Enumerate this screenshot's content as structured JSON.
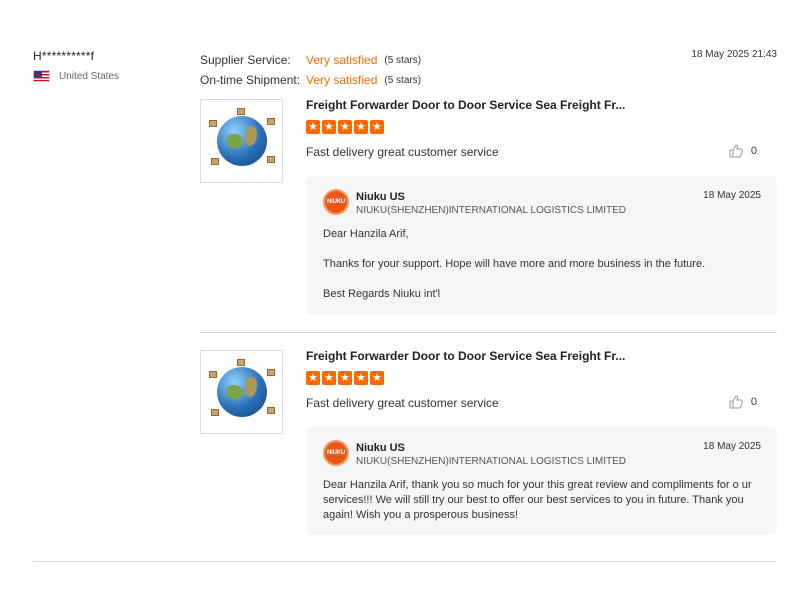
{
  "reviewer": {
    "name": "H**********f",
    "country": "United States",
    "flag_icon": "us-flag-icon"
  },
  "ratings": [
    {
      "label": "Supplier Service:",
      "value": "Very satisfied",
      "stars": "(5 stars)"
    },
    {
      "label": "On-time Shipment:",
      "value": "Very satisfied",
      "stars": "(5 stars)"
    }
  ],
  "timestamp": "18 May 2025 21:43",
  "entries": [
    {
      "product_title": "Freight Forwarder Door to Door Service Sea Freight Fr...",
      "star_count": 5,
      "comment": "Fast delivery great customer service",
      "likes": "0",
      "reply": {
        "logo_text": "NIUKU",
        "name": "Niuku US",
        "company": "NIUKU(SHENZHEN)INTERNATIONAL LOGISTICS LIMITED",
        "date": "18 May 2025",
        "paragraphs": [
          "Dear Hanzila Arif,",
          "Thanks for your support. Hope will have more and more business in the future.",
          "Best Regards Niuku int'l"
        ]
      }
    },
    {
      "product_title": "Freight Forwarder Door to Door Service Sea Freight Fr...",
      "star_count": 5,
      "comment": "Fast delivery great customer service",
      "likes": "0",
      "reply": {
        "logo_text": "NIUKU",
        "name": "Niuku US",
        "company": "NIUKU(SHENZHEN)INTERNATIONAL LOGISTICS LIMITED",
        "date": "18 May 2025",
        "paragraphs": [
          "Dear Hanzila Arif, thank you so much for your this great review and compliments for o ur services!!! We will still try our best to offer our best services to you in future. Thank you again! Wish you a prosperous business!"
        ]
      }
    }
  ],
  "colors": {
    "accent": "#ff6a00",
    "reply_bg": "#f5f6f8",
    "logo": "#e8571a"
  }
}
